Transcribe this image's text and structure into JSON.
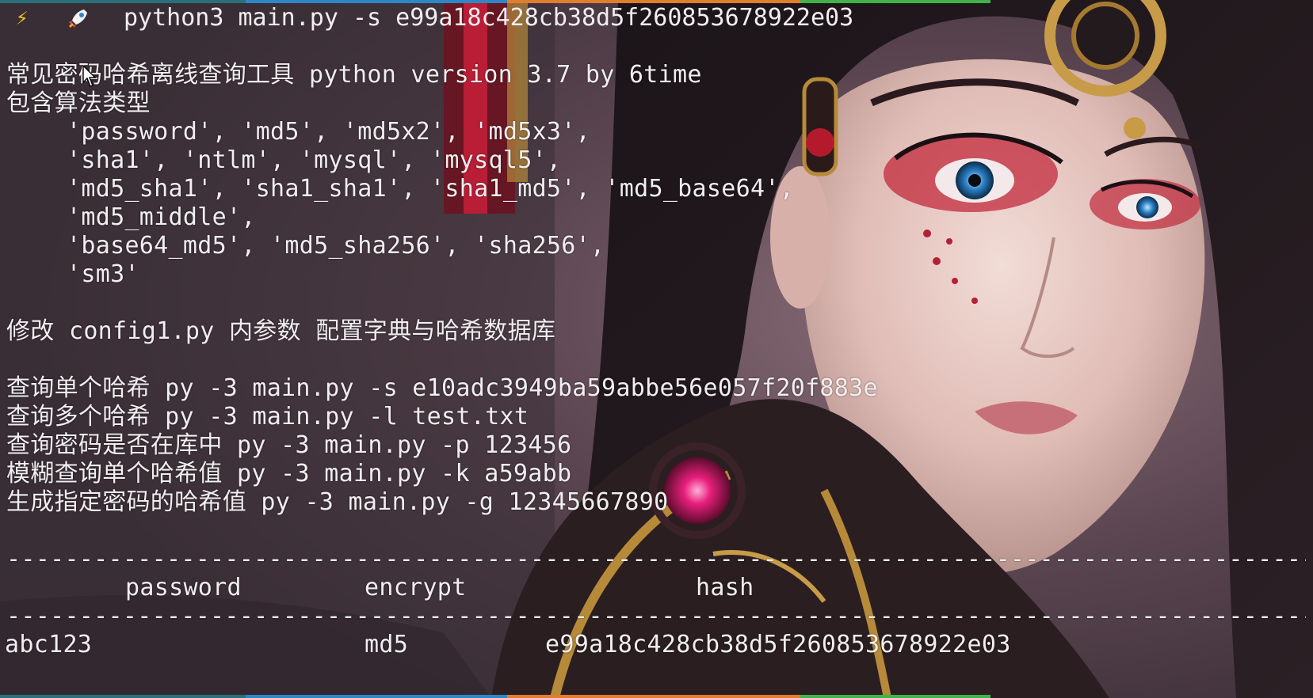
{
  "prompt": {
    "bolt_icon": "bolt-icon",
    "rocket_icon": "rocket-icon",
    "command": "python3 main.py -s e99a18c428cb38d5f260853678922e03"
  },
  "banner": {
    "title": "常见密码哈希离线查询工具 python version 3.7 by 6time",
    "algo_heading": "包含算法类型",
    "algo_lines": [
      "'password', 'md5', 'md5x2', 'md5x3',",
      "'sha1', 'ntlm', 'mysql', 'mysql5',",
      "'md5_sha1', 'sha1_sha1', 'sha1_md5', 'md5_base64',",
      "'md5_middle',",
      "'base64_md5', 'md5_sha256', 'sha256',",
      "'sm3'"
    ],
    "config_note": "修改 config1.py 内参数 配置字典与哈希数据库",
    "usage": [
      "查询单个哈希 py -3 main.py -s e10adc3949ba59abbe56e057f20f883e",
      "查询多个哈希 py -3 main.py -l test.txt",
      "查询密码是否在库中 py -3 main.py -p 123456",
      "模糊查询单个哈希值 py -3 main.py -k a59abb",
      "生成指定密码的哈希值 py -3 main.py -g 12345667890"
    ]
  },
  "results_table": {
    "separator": "-------------------------------------------------------------------------------------------------------",
    "headers": {
      "password": "password",
      "encrypt": "encrypt",
      "hash": "hash"
    },
    "rows": [
      {
        "password": "abc123",
        "encrypt": "md5",
        "hash": "e99a18c428cb38d5f260853678922e03"
      }
    ]
  },
  "colors": {
    "text": "#f1eef0",
    "background": "#3a2e36",
    "bolt": "#f7c623",
    "rocket": "#e84545"
  }
}
